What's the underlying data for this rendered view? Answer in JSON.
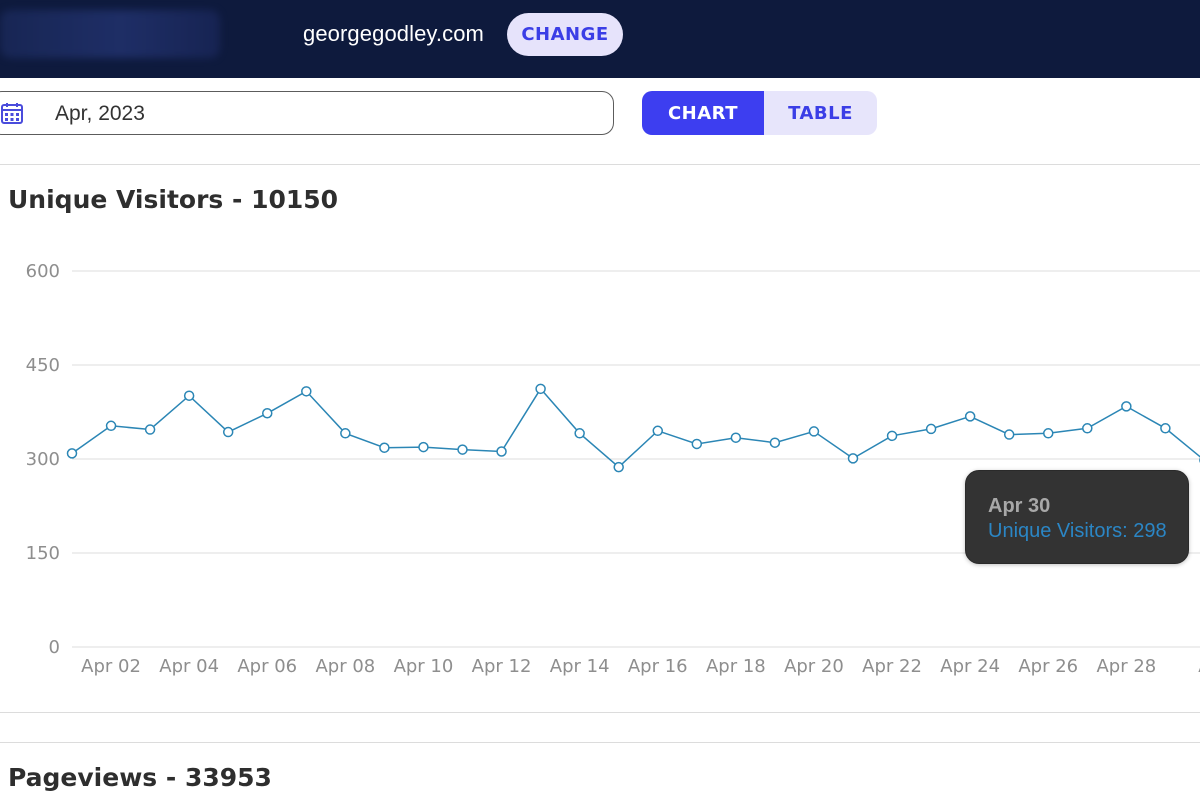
{
  "header": {
    "site": "georgegodley.com",
    "change_label": "CHANGE"
  },
  "filters": {
    "date_value": "Apr, 2023",
    "view_toggle": {
      "chart_label": "CHART",
      "table_label": "TABLE",
      "selected": "CHART"
    }
  },
  "colors": {
    "header_bg": "#0e1a3d",
    "accent": "#3d3ef0",
    "accent_light": "#e7e5fb",
    "series_line": "#2b86b5",
    "tooltip_bg": "#333333"
  },
  "icons": {
    "date_field": "calendar-icon"
  },
  "sections": {
    "unique_visitors": {
      "title": "Unique Visitors - 10150"
    },
    "pageviews": {
      "title": "Pageviews - 33953"
    }
  },
  "chart_data": {
    "type": "line",
    "title": "Unique Visitors - 10150",
    "xlabel": "",
    "ylabel": "",
    "ylim": [
      0,
      600
    ],
    "yticks": [
      0,
      150,
      300,
      450,
      600
    ],
    "grid": true,
    "x": [
      "Apr 01",
      "Apr 02",
      "Apr 03",
      "Apr 04",
      "Apr 05",
      "Apr 06",
      "Apr 07",
      "Apr 08",
      "Apr 09",
      "Apr 10",
      "Apr 11",
      "Apr 12",
      "Apr 13",
      "Apr 14",
      "Apr 15",
      "Apr 16",
      "Apr 17",
      "Apr 18",
      "Apr 19",
      "Apr 20",
      "Apr 21",
      "Apr 22",
      "Apr 23",
      "Apr 24",
      "Apr 25",
      "Apr 26",
      "Apr 27",
      "Apr 28",
      "Apr 29",
      "Apr 30"
    ],
    "xtick_labels": [
      "Apr 02",
      "Apr 04",
      "Apr 06",
      "Apr 08",
      "Apr 10",
      "Apr 12",
      "Apr 14",
      "Apr 16",
      "Apr 18",
      "Apr 20",
      "Apr 22",
      "Apr 24",
      "Apr 26",
      "Apr 28",
      "A"
    ],
    "series": [
      {
        "name": "Unique Visitors",
        "values": [
          309,
          353,
          347,
          401,
          343,
          373,
          408,
          341,
          318,
          319,
          315,
          312,
          412,
          341,
          287,
          345,
          324,
          334,
          326,
          344,
          301,
          337,
          348,
          368,
          339,
          341,
          349,
          384,
          349,
          298
        ]
      }
    ],
    "tooltip": {
      "title": "Apr 30",
      "text": "Unique Visitors: 298"
    }
  }
}
